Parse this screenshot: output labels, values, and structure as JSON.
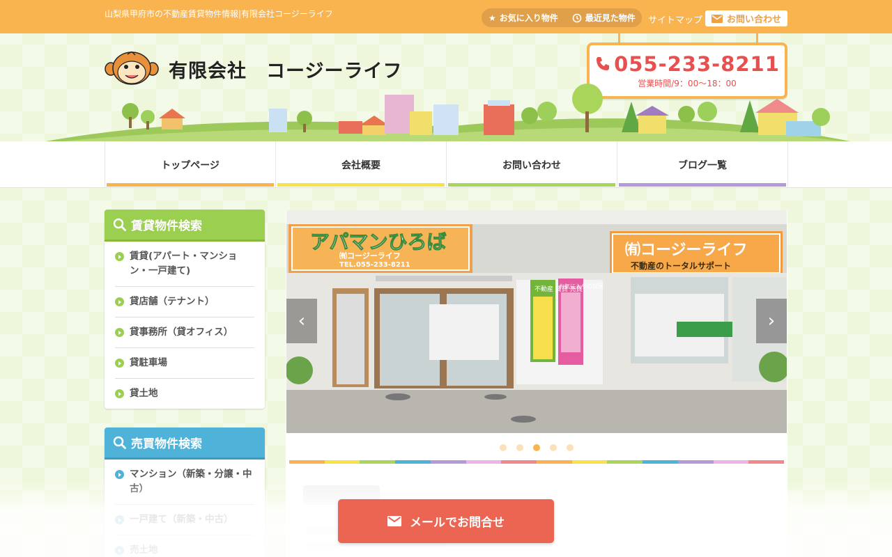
{
  "topbar": {
    "tagline": "山梨県甲府市の不動産賃貸物件情報|有限会社コージーライフ",
    "favorites": "お気に入り物件",
    "recent": "最近見た物件",
    "sitemap": "サイトマップ",
    "contact": "お問い合わせ"
  },
  "header": {
    "company": "有限会社　コージーライフ",
    "phone": "055-233-8211",
    "hours": "営業時間/9：00〜18：00"
  },
  "nav": {
    "items": [
      {
        "label": "トップページ",
        "color": "#f9b34f"
      },
      {
        "label": "会社概要",
        "color": "#f8e24a"
      },
      {
        "label": "お問い合わせ",
        "color": "#a9d65a"
      },
      {
        "label": "ブログ一覧",
        "color": "#b59ad9"
      }
    ]
  },
  "sidebar": {
    "rental": {
      "title": "賃貸物件検索",
      "color": "#9bcf4f",
      "items": [
        "賃貸(アパート・マンション・一戸建て)",
        "貸店舗（テナント）",
        "貸事務所（貸オフィス）",
        "貸駐車場",
        "貸土地"
      ]
    },
    "sale": {
      "title": "売買物件検索",
      "color": "#4fb2d9",
      "items": [
        "マンション（新築・分譲・中古）",
        "一戸建て（新築・中古）",
        "売土地"
      ]
    }
  },
  "slider": {
    "sign_left": "アパマンひろば",
    "sign_left_sub": "㈲コージーライフ",
    "sign_left_tel": "TEL.055-233-8211",
    "sign_right": "㈲コージーライフ",
    "sign_right_sub": "不動産のトータルサポート",
    "banner1": "不動産 賃貸 売買",
    "banner2": "お気に入りの部屋",
    "slide_count": 5,
    "active_index": 2,
    "stripe_colors": [
      "#f9b34f",
      "#f8e24a",
      "#a9d65a",
      "#4fb2d9",
      "#b59ad9",
      "#f0b3e3",
      "#f08a8a",
      "#f9b34f",
      "#f8e24a",
      "#a9d65a",
      "#4fb2d9",
      "#b59ad9",
      "#f0b3e3",
      "#f08a8a"
    ]
  },
  "mail_button": "メールでお問合せ"
}
